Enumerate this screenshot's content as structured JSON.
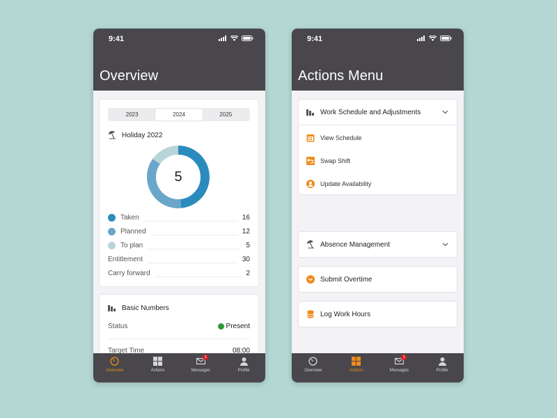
{
  "overview_screen": {
    "status_time": "9:41",
    "title": "Overview",
    "years": [
      "2023",
      "2024",
      "2025"
    ],
    "selected_year": "2024",
    "holiday_card": {
      "title": "Holiday 2022",
      "center_value": "5",
      "legend": [
        {
          "label": "Taken",
          "value": "16",
          "color": "#2b8bbd"
        },
        {
          "label": "Planned",
          "value": "12",
          "color": "#6aa6c9"
        },
        {
          "label": "To plan",
          "value": "5",
          "color": "#b9d5d9"
        }
      ],
      "entitlement_label": "Entitlement",
      "entitlement_value": "30",
      "carry_label": "Carry forward",
      "carry_value": "2"
    },
    "basic_numbers": {
      "title": "Basic Numbers",
      "status_label": "Status",
      "status_value": "Present",
      "status_color": "#2e9b39",
      "target_label": "Target Time",
      "target_value": "08:00"
    },
    "active_tab": "Overview"
  },
  "actions_screen": {
    "status_time": "9:41",
    "title": "Actions Menu",
    "work_schedule": {
      "title": "Work Schedule and Adjustments",
      "items": [
        {
          "label": "View Schedule",
          "icon": "calendar-icon"
        },
        {
          "label": "Swap Shift",
          "icon": "swap-icon"
        },
        {
          "label": "Update Availability",
          "icon": "person-icon"
        }
      ]
    },
    "absence": {
      "title": "Absence Management"
    },
    "overtime": {
      "title": "Submit Overtime"
    },
    "log_hours": {
      "title": "Log Work Hours"
    },
    "active_tab": "Actions"
  },
  "tabs": {
    "overview": "Overview",
    "actions": "Actions",
    "messages": "Messages",
    "profile": "Profile",
    "messages_badge": "1"
  },
  "colors": {
    "accent": "#ee8b1c",
    "header": "#49474b",
    "badge": "#d8202b"
  }
}
